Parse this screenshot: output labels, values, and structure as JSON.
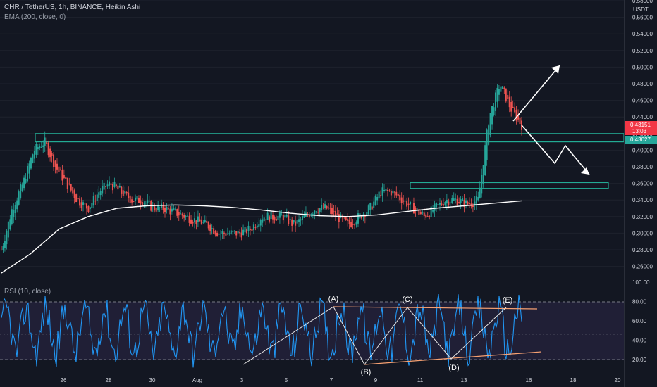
{
  "header": {
    "symbol_line": "CHR / TetherUS, 1h, BINANCE, Heikin Ashi",
    "ema_line": "EMA (200, close, 0)",
    "rsi_line": "RSI (10, close)"
  },
  "price_axis": {
    "currency": "USDT",
    "ticks": [
      "0.58000",
      "0.56000",
      "0.54000",
      "0.52000",
      "0.50000",
      "0.48000",
      "0.46000",
      "0.44000",
      "0.42000",
      "0.40000",
      "0.38000",
      "0.36000",
      "0.34000",
      "0.32000",
      "0.30000",
      "0.28000",
      "0.26000"
    ],
    "last_price_label": "0.43151",
    "countdown_label": "13:03",
    "ema_label": "0.43027",
    "last_color": "#f23645",
    "ema_color": "#26a69a"
  },
  "rsi_axis": {
    "ticks": [
      "100.00",
      "80.00",
      "60.00",
      "40.00",
      "20.00"
    ]
  },
  "time_axis": {
    "ticks": [
      "26",
      "28",
      "30",
      "Aug",
      "3",
      "5",
      "7",
      "9",
      "11",
      "13",
      "16",
      "18",
      "20"
    ]
  },
  "annotations": {
    "points": [
      "(A)",
      "(B)",
      "(C)",
      "(D)",
      "(E)"
    ]
  },
  "colors": {
    "up": "#26a69a",
    "down": "#ef5350",
    "rect": "#22ab94",
    "ema": "#ffffff",
    "rsi": "#2196f3",
    "trend": "#f7a172"
  },
  "chart_data": {
    "type": "candlestick",
    "series": [
      {
        "name": "CHR / TetherUS",
        "approx_close": [
          0.28,
          0.33,
          0.36,
          0.4,
          0.41,
          0.38,
          0.36,
          0.34,
          0.33,
          0.35,
          0.36,
          0.35,
          0.34,
          0.34,
          0.33,
          0.33,
          0.325,
          0.32,
          0.315,
          0.31,
          0.3,
          0.3,
          0.3,
          0.305,
          0.32,
          0.32,
          0.32,
          0.31,
          0.32,
          0.33,
          0.33,
          0.32,
          0.31,
          0.32,
          0.33,
          0.35,
          0.35,
          0.34,
          0.33,
          0.32,
          0.33,
          0.34,
          0.34,
          0.335,
          0.34,
          0.44,
          0.48,
          0.45,
          0.43
        ]
      },
      {
        "name": "EMA (200, close, 0)",
        "approx_values": [
          0.252,
          0.275,
          0.305,
          0.32,
          0.33,
          0.333,
          0.334,
          0.333,
          0.331,
          0.328,
          0.324,
          0.321,
          0.32,
          0.322,
          0.326,
          0.33,
          0.333,
          0.336,
          0.339
        ]
      }
    ],
    "rsi": {
      "name": "RSI (10, close)",
      "range": [
        0,
        100
      ],
      "overbought": 80,
      "oversold": 20
    },
    "horizontal_zones": [
      {
        "low": 0.41,
        "high": 0.42
      },
      {
        "low": 0.354,
        "high": 0.361
      }
    ],
    "ylim": [
      0.25,
      0.58
    ]
  }
}
